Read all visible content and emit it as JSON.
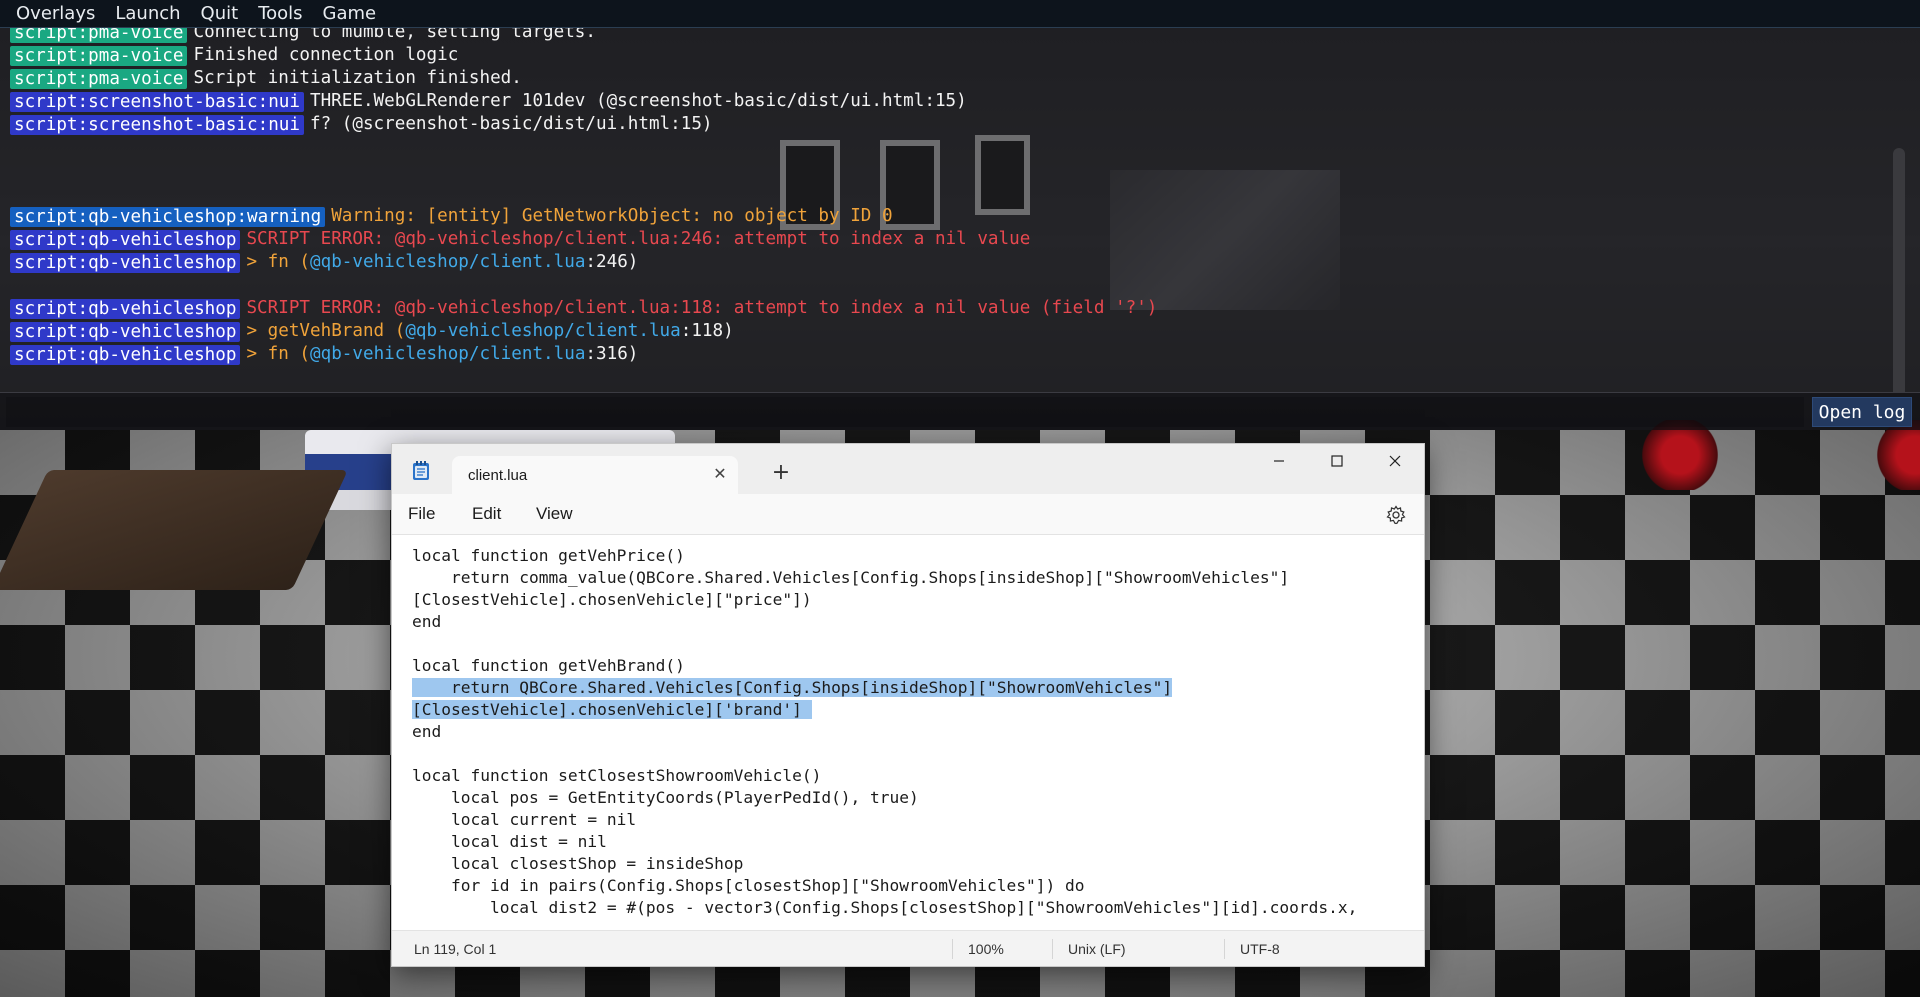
{
  "menubar": {
    "items": [
      "Overlays",
      "Launch",
      "Quit",
      "Tools",
      "Game"
    ]
  },
  "console": {
    "lines": [
      {
        "tag": "script:pma-voice",
        "tag_color": "green",
        "parts": [
          {
            "text": "Connecting to mumble, setting targets.",
            "color": "white"
          }
        ]
      },
      {
        "tag": "script:pma-voice",
        "tag_color": "green",
        "parts": [
          {
            "text": "Finished connection logic",
            "color": "white"
          }
        ]
      },
      {
        "tag": "script:pma-voice",
        "tag_color": "green",
        "parts": [
          {
            "text": "Script initialization finished.",
            "color": "white"
          }
        ]
      },
      {
        "tag": "script:screenshot-basic:nui",
        "tag_color": "blue",
        "parts": [
          {
            "text": "THREE.WebGLRenderer 101dev (@screenshot-basic/dist/ui.html:15)",
            "color": "white"
          }
        ]
      },
      {
        "tag": "script:screenshot-basic:nui",
        "tag_color": "blue",
        "parts": [
          {
            "text": "f? (@screenshot-basic/dist/ui.html:15)",
            "color": "white"
          }
        ]
      },
      {
        "blank": true
      },
      {
        "blank": true
      },
      {
        "blank": true
      },
      {
        "tag": "script:qb-vehicleshop:warning",
        "tag_color": "warn",
        "parts": [
          {
            "text": "Warning: [entity] GetNetworkObject: no object by ID 0",
            "color": "yellow"
          }
        ]
      },
      {
        "tag": "script:qb-vehicleshop",
        "tag_color": "blue",
        "parts": [
          {
            "text": "SCRIPT ERROR: @qb-vehicleshop/client.lua:246: attempt to index a nil value",
            "color": "red"
          }
        ]
      },
      {
        "tag": "script:qb-vehicleshop",
        "tag_color": "blue",
        "parts": [
          {
            "text": "> fn (",
            "color": "yellow"
          },
          {
            "text": "@qb-vehicleshop/client.lua",
            "color": "link"
          },
          {
            "text": ":246)",
            "color": "white"
          }
        ]
      },
      {
        "blank": true
      },
      {
        "tag": "script:qb-vehicleshop",
        "tag_color": "blue",
        "parts": [
          {
            "text": "SCRIPT ERROR: @qb-vehicleshop/client.lua:118: attempt to index a nil value (field '?')",
            "color": "red"
          }
        ]
      },
      {
        "tag": "script:qb-vehicleshop",
        "tag_color": "blue",
        "parts": [
          {
            "text": "> getVehBrand (",
            "color": "yellow"
          },
          {
            "text": "@qb-vehicleshop/client.lua",
            "color": "link"
          },
          {
            "text": ":118)",
            "color": "white"
          }
        ]
      },
      {
        "tag": "script:qb-vehicleshop",
        "tag_color": "blue",
        "parts": [
          {
            "text": "> fn (",
            "color": "yellow"
          },
          {
            "text": "@qb-vehicleshop/client.lua",
            "color": "link"
          },
          {
            "text": ":316)",
            "color": "white"
          }
        ]
      }
    ],
    "input_value": "",
    "open_log_label": "Open log"
  },
  "notepad": {
    "tab_title": "client.lua",
    "tab_close_glyph": "✕",
    "new_tab_glyph": "+",
    "menu": {
      "file": "File",
      "edit": "Edit",
      "view": "View"
    },
    "code": [
      {
        "text": "local function getVehPrice()"
      },
      {
        "text": "    return comma_value(QBCore.Shared.Vehicles[Config.Shops[insideShop][\"ShowroomVehicles\"]"
      },
      {
        "text": "[ClosestVehicle].chosenVehicle][\"price\"])"
      },
      {
        "text": "end"
      },
      {
        "text": ""
      },
      {
        "text": "local function getVehBrand()"
      },
      {
        "text": "    return QBCore.Shared.Vehicles[Config.Shops[insideShop][\"ShowroomVehicles\"]",
        "highlight": true
      },
      {
        "text": "[ClosestVehicle].chosenVehicle]['brand'] ",
        "highlight": true
      },
      {
        "text": "end"
      },
      {
        "text": ""
      },
      {
        "text": "local function setClosestShowroomVehicle()"
      },
      {
        "text": "    local pos = GetEntityCoords(PlayerPedId(), true)"
      },
      {
        "text": "    local current = nil"
      },
      {
        "text": "    local dist = nil"
      },
      {
        "text": "    local closestShop = insideShop"
      },
      {
        "text": "    for id in pairs(Config.Shops[closestShop][\"ShowroomVehicles\"]) do"
      },
      {
        "text": "        local dist2 = #(pos - vector3(Config.Shops[closestShop][\"ShowroomVehicles\"][id].coords.x,"
      }
    ],
    "status": {
      "position": "Ln 119, Col 1",
      "zoom": "100%",
      "line_ending": "Unix (LF)",
      "encoding": "UTF-8"
    }
  },
  "colors": {
    "tag_green": "#1aa882",
    "tag_blue": "#2f39c9",
    "tag_warn": "#1560c0",
    "text_red": "#e8484f",
    "text_yellow": "#f0a33a",
    "text_link": "#41a9e8",
    "selection": "#9ec7ef"
  }
}
